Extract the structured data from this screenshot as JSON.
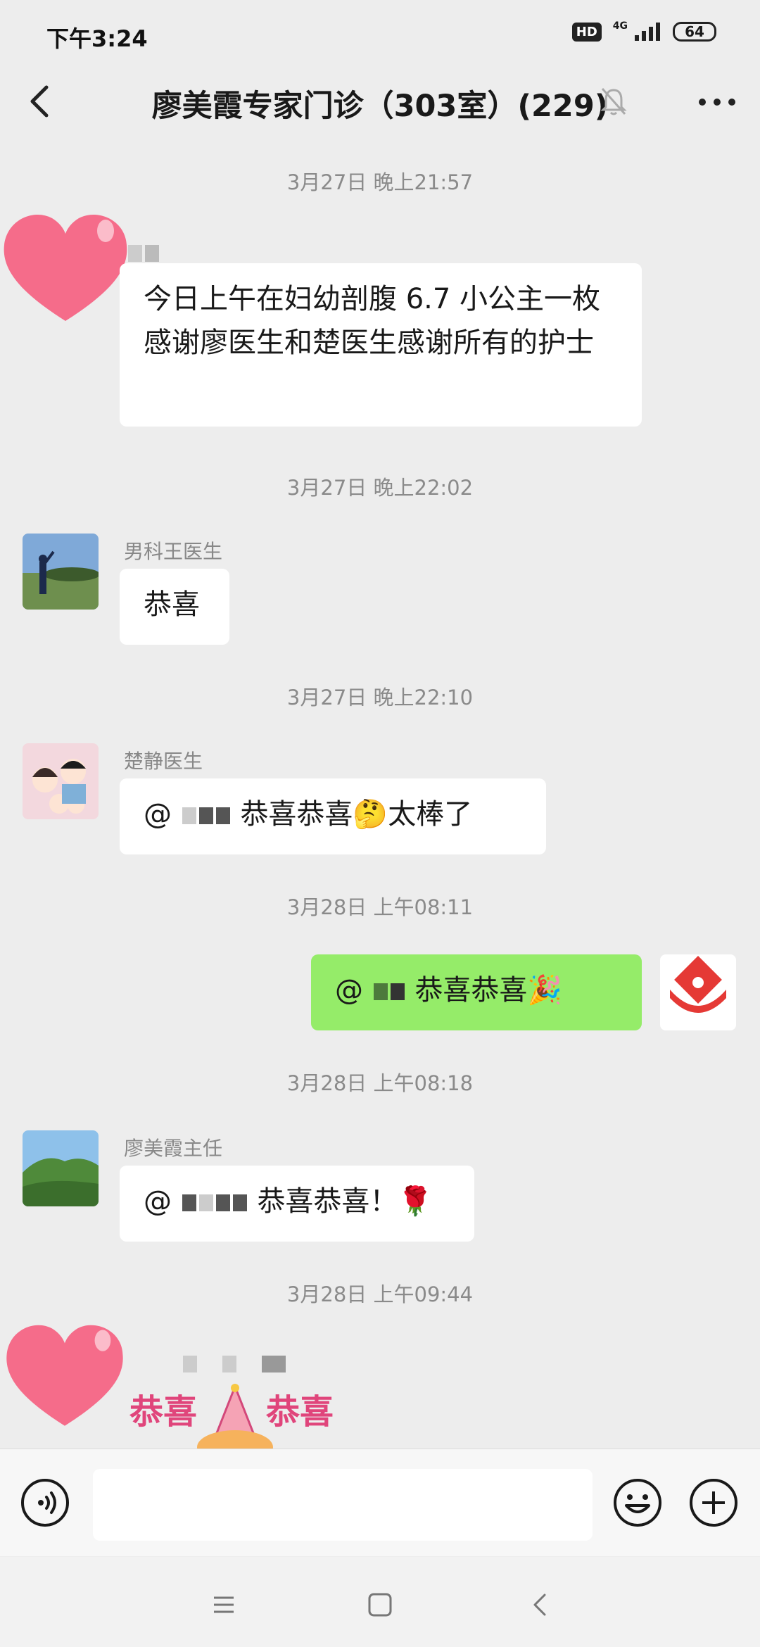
{
  "status_bar": {
    "time": "下午3:24",
    "hd": "HD",
    "network": "4G",
    "battery": "64"
  },
  "header": {
    "title": "廖美霞专家门诊（303室）(229)"
  },
  "timestamps": [
    "3月27日 晚上21:57",
    "3月27日 晚上22:02",
    "3月27日 晚上22:10",
    "3月28日 上午08:11",
    "3月28日 上午08:18",
    "3月28日 上午09:44"
  ],
  "messages": [
    {
      "sender": "",
      "text": "今日上午在妇幼剖腹 6.7 小公主一枚感谢廖医生和楚医生感谢所有的护士"
    },
    {
      "sender": "男科王医生",
      "text": "恭喜"
    },
    {
      "sender": "楚静医生",
      "mention": "@",
      "text": "恭喜恭喜🤔太棒了"
    },
    {
      "sender": "me",
      "mention": "@",
      "text": "恭喜恭喜🎉"
    },
    {
      "sender": "廖美霞主任",
      "mention": "@",
      "text": "恭喜恭喜！🌹"
    },
    {
      "sender": "",
      "sticker_left": "恭喜",
      "sticker_right": "恭喜"
    }
  ],
  "input": {
    "placeholder": ""
  },
  "colors": {
    "background": "#ededed",
    "bubble_me": "#95ec69",
    "bubble_other": "#ffffff",
    "sticker_text": "#e0457b",
    "heart": "#f56c8a"
  },
  "icons": [
    "back-arrow-icon",
    "mute-bell-icon",
    "more-icon",
    "voice-icon",
    "emoji-icon",
    "plus-icon",
    "menu-icon",
    "home-icon",
    "nav-back-icon"
  ]
}
